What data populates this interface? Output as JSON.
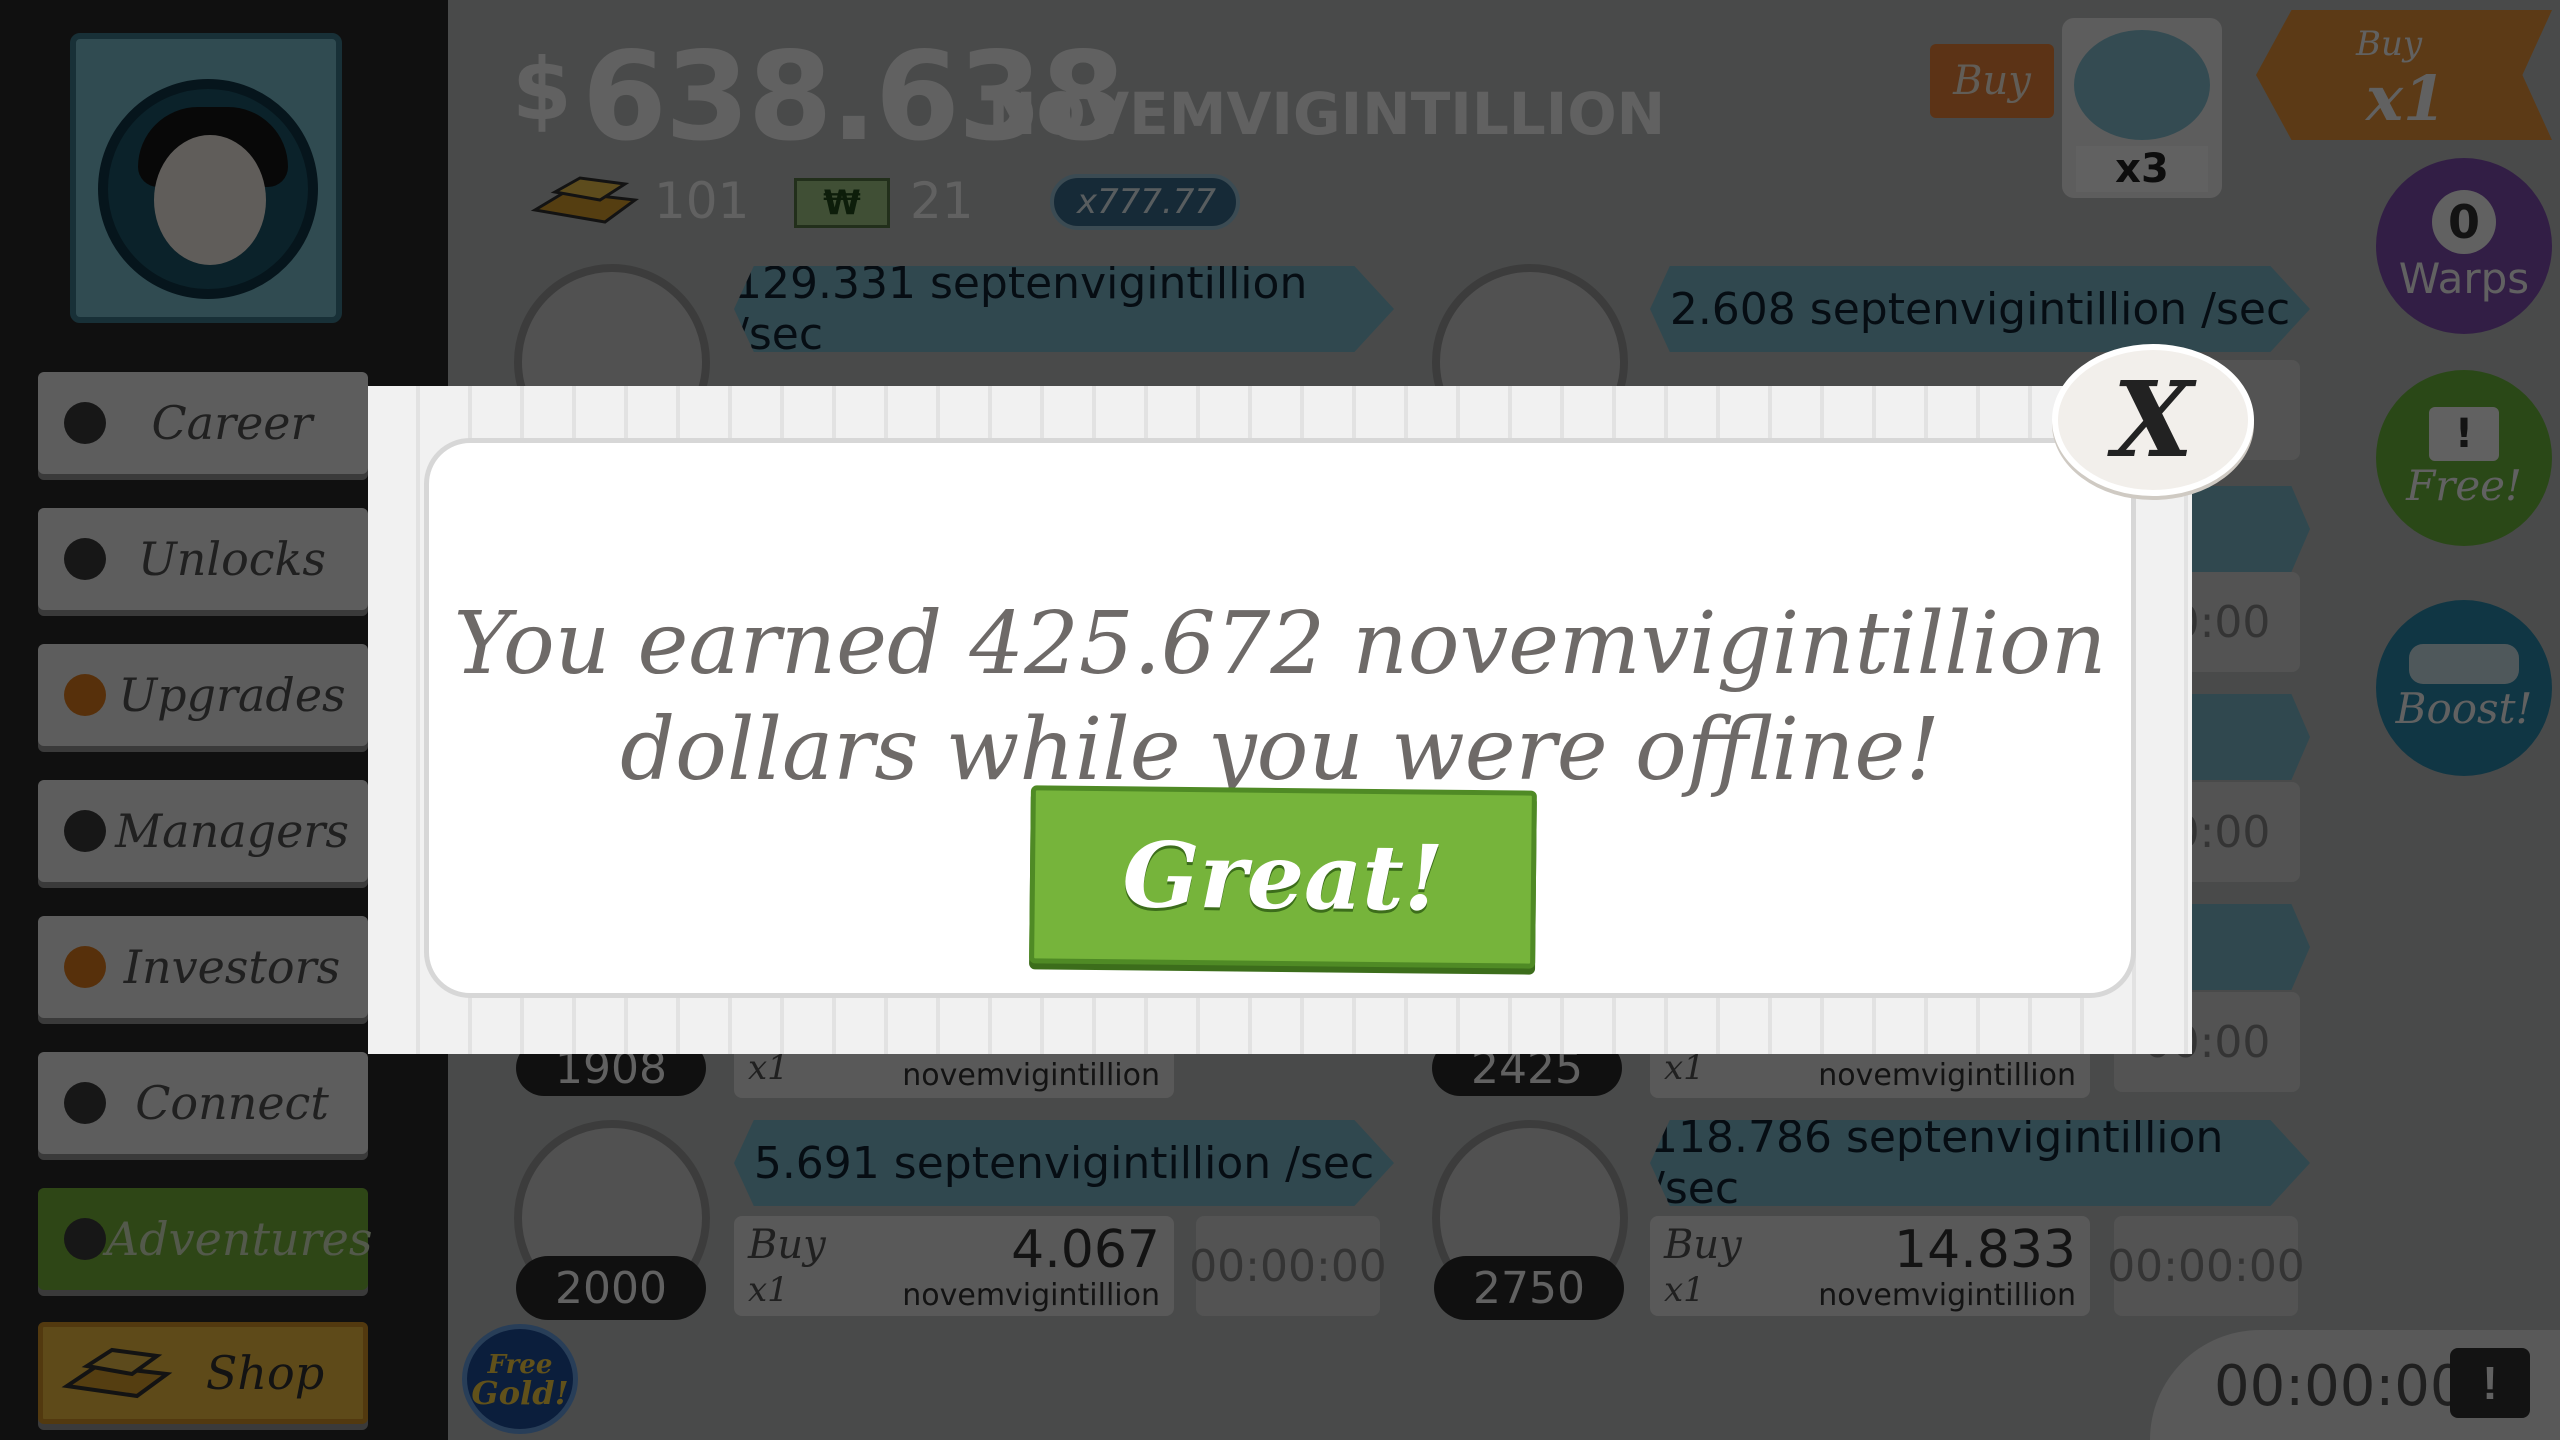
{
  "hud": {
    "money_symbol": "$",
    "money_value": "638.638",
    "money_unit": "NOVEMVIGINTILLION",
    "gold_count": "101",
    "megabucks_count": "21",
    "multiplier": "x777.77",
    "buy_label": "Buy",
    "buy_mode_line1": "Buy",
    "buy_mode_line2": "x1",
    "video_multiplier": "x3"
  },
  "sidebar": {
    "items": [
      {
        "label": "Career"
      },
      {
        "label": "Unlocks"
      },
      {
        "label": "Upgrades"
      },
      {
        "label": "Managers"
      },
      {
        "label": "Investors"
      },
      {
        "label": "Connect"
      },
      {
        "label": "Adventures"
      },
      {
        "label": "Shop"
      }
    ],
    "free_gold_line1": "Free",
    "free_gold_line2": "Gold!"
  },
  "right_panel": {
    "warps_count": "0",
    "warps_label": "Warps",
    "free_label": "Free!",
    "boost_label": "Boost!",
    "bottom_timer": "00:00:00"
  },
  "businesses": {
    "row1_left_rate": "129.331 septenvigintillion /sec",
    "row1_right_rate": "2.608 septenvigintillion /sec",
    "row_mid_left_count": "1908",
    "row_mid_right_count": "2425",
    "row_mid_x1": "x1",
    "row_mid_unit": "novemvigintillion",
    "row_last_left_rate": "5.691 septenvigintillion /sec",
    "row_last_right_rate": "118.786 septenvigintillion /sec",
    "row_last_left_count": "2000",
    "row_last_right_count": "2750",
    "row_last_left_cost": "4.067",
    "row_last_right_cost": "14.833",
    "cost_unit": "novemvigintillion",
    "buy_word": "Buy",
    "buy_x1": "x1",
    "timer": "00:00:00",
    "right_timers": [
      "00",
      "00:00",
      "00:00",
      "00:00"
    ]
  },
  "modal": {
    "message_line1": "You earned 425.672 novemvigintillion",
    "message_line2": "dollars while you were offline!",
    "great_button": "Great!",
    "close_label": "X"
  }
}
